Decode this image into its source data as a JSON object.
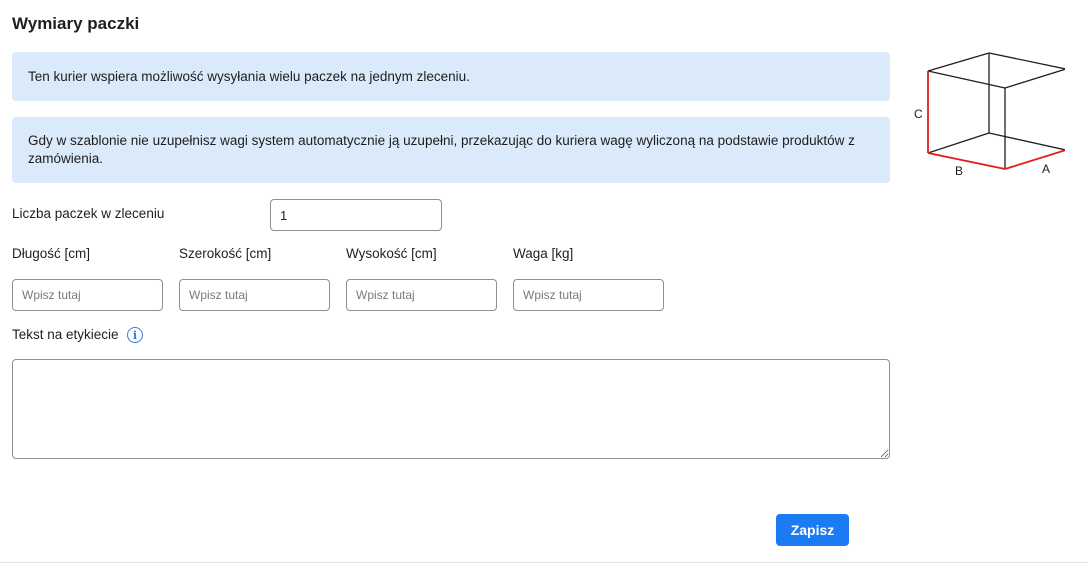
{
  "section": {
    "title": "Wymiary paczki"
  },
  "info": {
    "multi_package": "Ten kurier wspiera możliwość wysyłania wielu paczek na jednym zleceniu.",
    "auto_weight": "Gdy w szablonie nie uzupełnisz wagi system automatycznie ją uzupełni, przekazując do kuriera wagę wyliczoną na podstawie produktów z zamówienia."
  },
  "package_count": {
    "label": "Liczba paczek w zleceniu",
    "value": "1"
  },
  "dimensions": {
    "length": {
      "label": "Długość [cm]",
      "placeholder": "Wpisz tutaj"
    },
    "width": {
      "label": "Szerokość [cm]",
      "placeholder": "Wpisz tutaj"
    },
    "height": {
      "label": "Wysokość [cm]",
      "placeholder": "Wpisz tutaj"
    },
    "weight": {
      "label": "Waga [kg]",
      "placeholder": "Wpisz tutaj"
    }
  },
  "label_text": {
    "label": "Tekst na etykiecie",
    "info_icon": "i",
    "value": ""
  },
  "diagram": {
    "label_c": "C",
    "label_b": "B",
    "label_a": "A",
    "highlight_color": "#e01e1e",
    "line_color": "#1f1f1f"
  },
  "actions": {
    "save_label": "Zapisz",
    "save_color": "#1a7bf2"
  },
  "colors": {
    "info_background": "#dbeafb"
  }
}
